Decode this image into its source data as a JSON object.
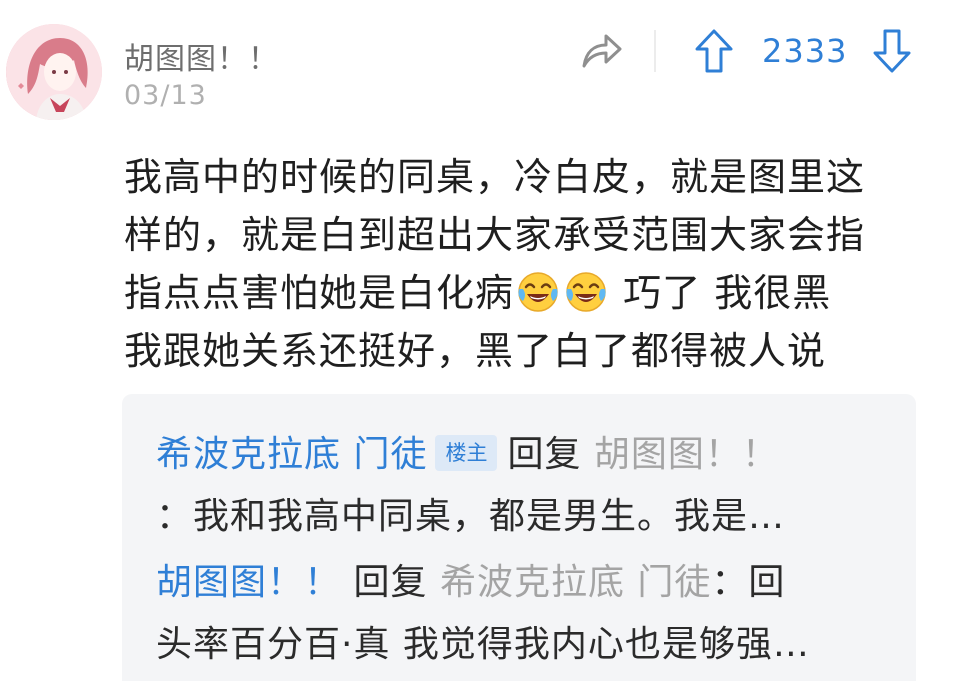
{
  "comment": {
    "username": "胡图图！！",
    "date": "03/13",
    "vote_count": "2333",
    "body_lines": [
      "我高中的时候的同桌，冷白皮，就是图里这",
      "样的，就是白到超出大家承受范围大家会指",
      "指点点害怕她是白化病",
      "巧了 我很黑",
      "我跟她关系还挺好，黑了白了都得被人说"
    ],
    "emoji_name": "tears-of-joy-emoji",
    "icons": {
      "share": "share-icon",
      "upvote": "upvote-arrow-icon",
      "downvote": "downvote-arrow-icon"
    }
  },
  "replies": [
    {
      "author": "希波克拉底 门徒",
      "badge": "楼主",
      "reply_word": "回复",
      "target": "胡图图！！",
      "text_line1": "：我和我高中同桌，都是男生。我是…"
    },
    {
      "author": "胡图图！！",
      "reply_word": "回复",
      "target": "希波克拉底 门徒",
      "text_tail": "：回",
      "text_line2": "头率百分百·真 我觉得我内心也是够强…"
    }
  ],
  "colors": {
    "accent_blue": "#2f7fd6",
    "muted_gray": "#a4a4a4",
    "reply_bg": "#f4f5f7"
  }
}
